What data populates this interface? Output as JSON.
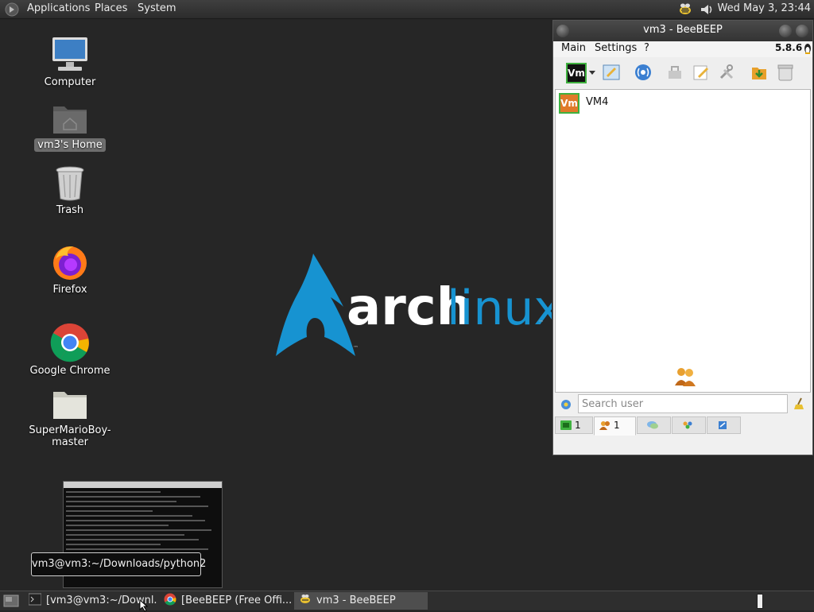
{
  "topbar": {
    "menus": [
      "Applications",
      "Places",
      "System"
    ],
    "clock": "Wed May  3, 23:44"
  },
  "desktop": {
    "icons": [
      {
        "label": "Computer",
        "icon": "computer-icon"
      },
      {
        "label": "vm3's Home",
        "icon": "home-folder-icon",
        "selected": true
      },
      {
        "label": "Trash",
        "icon": "trash-icon"
      },
      {
        "label": "Firefox",
        "icon": "firefox-icon"
      },
      {
        "label": "Google Chrome",
        "icon": "chrome-icon"
      },
      {
        "label": "SuperMarioBoy-master",
        "icon": "folder-icon"
      }
    ],
    "wallpaper": {
      "text_arch": "arch",
      "text_linux": "linux",
      "tm": "™"
    }
  },
  "tooltip": "vm3@vm3:~/Downloads/python2",
  "taskbar": {
    "tasks": [
      {
        "label": "[vm3@vm3:~/Downl...",
        "icon": "terminal-icon"
      },
      {
        "label": "[BeeBEEP (Free Offi...",
        "icon": "chrome-icon"
      },
      {
        "label": "vm3 - BeeBEEP",
        "icon": "bee-icon",
        "active": true
      }
    ]
  },
  "beebeep": {
    "title": "vm3 - BeeBEEP",
    "menu": [
      "Main",
      "Settings",
      "?"
    ],
    "version": "5.8.6",
    "status_badge": "Vm",
    "users": [
      {
        "badge": "Vm",
        "name": "VM4"
      }
    ],
    "search_placeholder": "Search user",
    "tabs": [
      {
        "icon": "users-online-icon",
        "count": "1"
      },
      {
        "icon": "users-icon",
        "count": "1",
        "active": true
      },
      {
        "icon": "chats-icon",
        "count": ""
      },
      {
        "icon": "groups-icon",
        "count": ""
      },
      {
        "icon": "file-sharing-icon",
        "count": ""
      }
    ]
  },
  "colors": {
    "arch_blue": "#1793d1",
    "panel_dark": "#2e2e2e",
    "badge_orange": "#e07a2a",
    "badge_green": "#3fb13f"
  }
}
